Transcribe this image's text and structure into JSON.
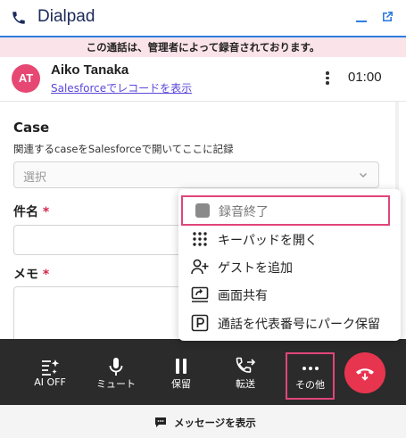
{
  "app": {
    "title": "Dialpad"
  },
  "banner": {
    "text": "この通話は、管理者によって録音されております。"
  },
  "caller": {
    "initials": "AT",
    "name": "Aiko Tanaka",
    "link": "Salesforceでレコードを表示",
    "timer": "01:00",
    "avatar_color": "#e64873"
  },
  "form": {
    "case_label": "Case",
    "case_description": "関連するcaseをSalesforceで開いてここに記録",
    "case_select_placeholder": "選択",
    "subject_label": "件名",
    "memo_label": "メモ",
    "required_mark": "*"
  },
  "menu": {
    "items": [
      {
        "icon": "stop-recording-icon",
        "label": "録音終了"
      },
      {
        "icon": "keypad-icon",
        "label": "キーパッドを開く"
      },
      {
        "icon": "add-guest-icon",
        "label": "ゲストを追加"
      },
      {
        "icon": "screen-share-icon",
        "label": "画面共有"
      },
      {
        "icon": "park-icon",
        "label": "通話を代表番号にパーク保留"
      }
    ]
  },
  "toolbar": {
    "ai_off": "AI OFF",
    "mute": "ミュート",
    "hold": "保留",
    "transfer": "転送",
    "more": "その他"
  },
  "footer": {
    "message_label": "メッセージを表示"
  },
  "colors": {
    "accent_blue": "#2f7de1",
    "highlight_pink": "#e0457b",
    "hangup_red": "#e8354f",
    "link_purple": "#5a47d9"
  }
}
